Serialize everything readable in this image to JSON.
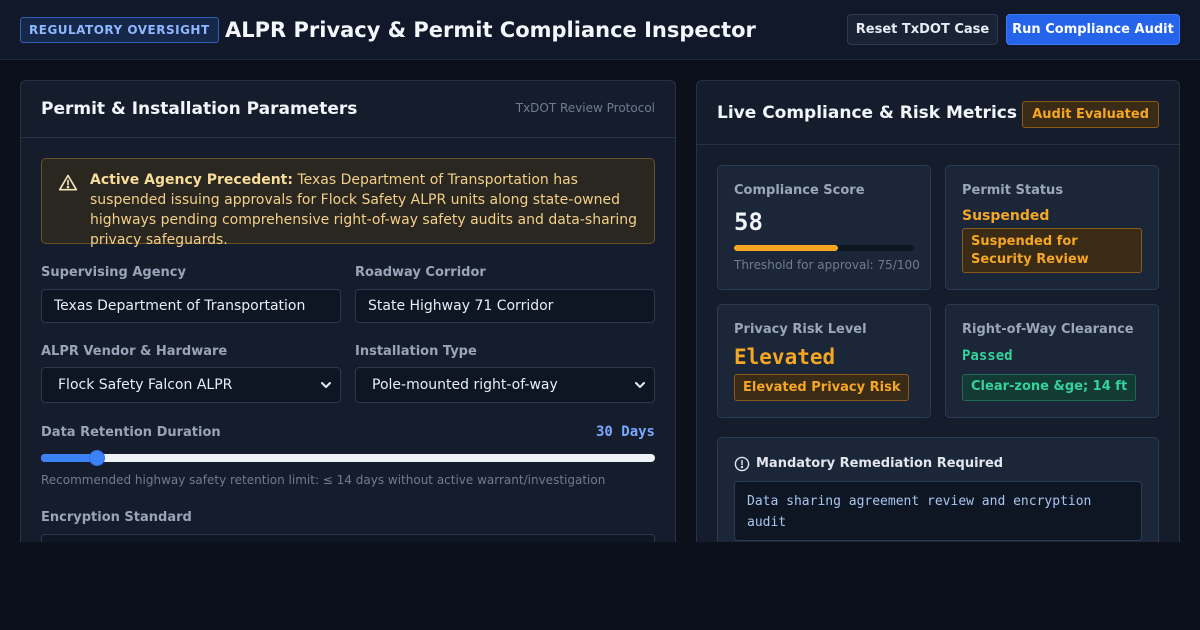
{
  "header": {
    "badge": "REGULATORY OVERSIGHT",
    "title": "ALPR Privacy & Permit Compliance Inspector",
    "reset_button": "Reset TxDOT Case",
    "run_button": "Run Compliance Audit"
  },
  "left_panel": {
    "title": "Permit & Installation Parameters",
    "subtitle": "TxDOT Review Protocol",
    "alert": {
      "icon": "warning-triangle-icon",
      "lead": "Active Agency Precedent:",
      "body": "Texas Department of Transportation has suspended issuing approvals for Flock Safety ALPR units along state-owned highways pending comprehensive right-of-way safety audits and data-sharing privacy safeguards."
    },
    "fields": {
      "agency_label": "Supervising Agency",
      "agency_value": "Texas Department of Transportation",
      "corridor_label": "Roadway Corridor",
      "corridor_value": "State Highway 71 Corridor",
      "vendor_label": "ALPR Vendor & Hardware",
      "vendor_value": "Flock Safety Falcon ALPR",
      "install_label": "Installation Type",
      "install_value": "Pole-mounted right-of-way",
      "retention_label": "Data Retention Duration",
      "retention_value": "30 Days",
      "retention_fraction": 0.092,
      "retention_hint": "Recommended highway safety retention limit: ≤ 14 days without active warrant/investigation",
      "encryption_label": "Encryption Standard"
    }
  },
  "right_panel": {
    "title": "Live Compliance & Risk Metrics",
    "badge": "Audit Evaluated",
    "compliance": {
      "label": "Compliance Score",
      "value": "58",
      "score_fraction": 0.58,
      "threshold": "Threshold for approval: 75/100"
    },
    "permit": {
      "label": "Permit Status",
      "value": "Suspended",
      "pill": "Suspended for Security Review"
    },
    "privacy": {
      "label": "Privacy Risk Level",
      "value": "Elevated",
      "pill": "Elevated Privacy Risk"
    },
    "row": {
      "label": "Right-of-Way Clearance",
      "value": "Passed",
      "pill": "Clear-zone &ge; 14 ft"
    },
    "remediation": {
      "icon": "info-circle-icon",
      "title": "Mandatory Remediation Required",
      "text": "Data sharing agreement review and encryption audit"
    }
  },
  "colors": {
    "accent": "#2563eb",
    "warning": "#f5a623",
    "success": "#34d399"
  }
}
